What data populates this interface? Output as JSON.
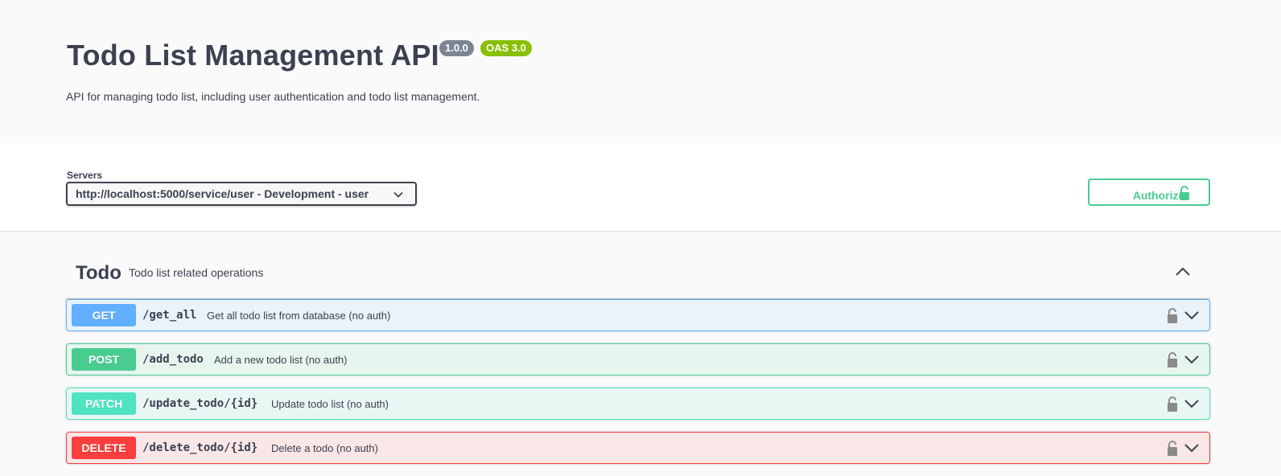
{
  "info": {
    "title": "Todo List Management API",
    "version_badge": "1.0.0",
    "oas_badge": "OAS 3.0",
    "description": "API for managing todo list, including user authentication and todo list management."
  },
  "scheme": {
    "servers_label": "Servers",
    "selected_server": "http://localhost:5000/service/user - Development - user",
    "authorize_label": "Authorize"
  },
  "tag": {
    "name": "Todo",
    "description": "Todo list related operations",
    "expanded": true
  },
  "operations": [
    {
      "method": "GET",
      "path": "/get_all",
      "summary": "Get all todo list from database (no auth)",
      "color": "#61affe"
    },
    {
      "method": "POST",
      "path": "/add_todo",
      "summary": "Add a new todo list (no auth)",
      "color": "#49cc90"
    },
    {
      "method": "PATCH",
      "path": "/update_todo/{id}",
      "summary": "Update todo list (no auth)",
      "color": "#50e3c2"
    },
    {
      "method": "DELETE",
      "path": "/delete_todo/{id}",
      "summary": "Delete a todo (no auth)",
      "color": "#f93e3e"
    }
  ],
  "colors": {
    "text": "#3b4151",
    "authorize": "#49cc90",
    "version_badge": "#7d8492",
    "oas_badge": "#89bf04"
  }
}
